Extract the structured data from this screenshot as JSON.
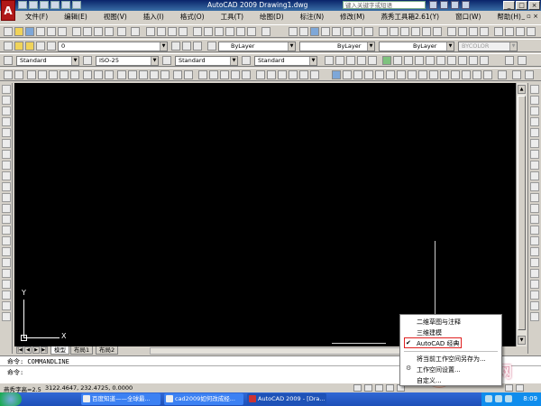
{
  "app": {
    "logo_letter": "A",
    "title": "AutoCAD 2009  Drawing1.dwg",
    "help_search_placeholder": "键入关键字或短语"
  },
  "window_controls": {
    "minimize": "_",
    "maximize": "□",
    "close": "×"
  },
  "menu": {
    "items": [
      "文件(F)",
      "编辑(E)",
      "视图(V)",
      "插入(I)",
      "格式(O)",
      "工具(T)",
      "绘图(D)",
      "标注(N)",
      "修改(M)",
      "燕秀工具箱2.61(Y)",
      "窗口(W)",
      "帮助(H)"
    ],
    "restore_symbol": "_ ▫ ×"
  },
  "toolbars": {
    "layer_value": "0",
    "color_value": "ByLayer",
    "linetype_value": "ByLayer",
    "lineweight_value": "ByLayer",
    "plotstyle_value": "BYCOLOR",
    "text_style": "Standard",
    "dim_style": "ISO-25",
    "table_style": "Standard",
    "multileader_style": "Standard"
  },
  "ucs": {
    "x_label": "X",
    "y_label": "Y"
  },
  "tabs": {
    "items": [
      "模型",
      "布局1",
      "布局2"
    ],
    "active_index": 0
  },
  "command": {
    "line1": "命令: COMMANDLINE",
    "line2": "命令:"
  },
  "status": {
    "left_label": "燕秀字高=2.5",
    "coords": "3122.4647, 232.4725, 0.0000"
  },
  "context_menu": {
    "items": [
      {
        "label": "二维草图与注释",
        "checked": false
      },
      {
        "label": "三维建模",
        "checked": false
      },
      {
        "label": "AutoCAD 经典",
        "checked": true
      },
      {
        "label": "将当前工作空间另存为...",
        "checked": false
      },
      {
        "label": "工作空间设置...",
        "checked": false
      },
      {
        "label": "自定义...",
        "checked": false
      }
    ],
    "check_mark": "✔"
  },
  "watermark": {
    "text": "小狐狸网"
  },
  "taskbar": {
    "buttons": [
      {
        "label": "百度知道——全球最..."
      },
      {
        "label": "cad2009如何改成经..."
      },
      {
        "label": "AutoCAD 2009 - [Dra..."
      }
    ],
    "clock": "8:09"
  }
}
